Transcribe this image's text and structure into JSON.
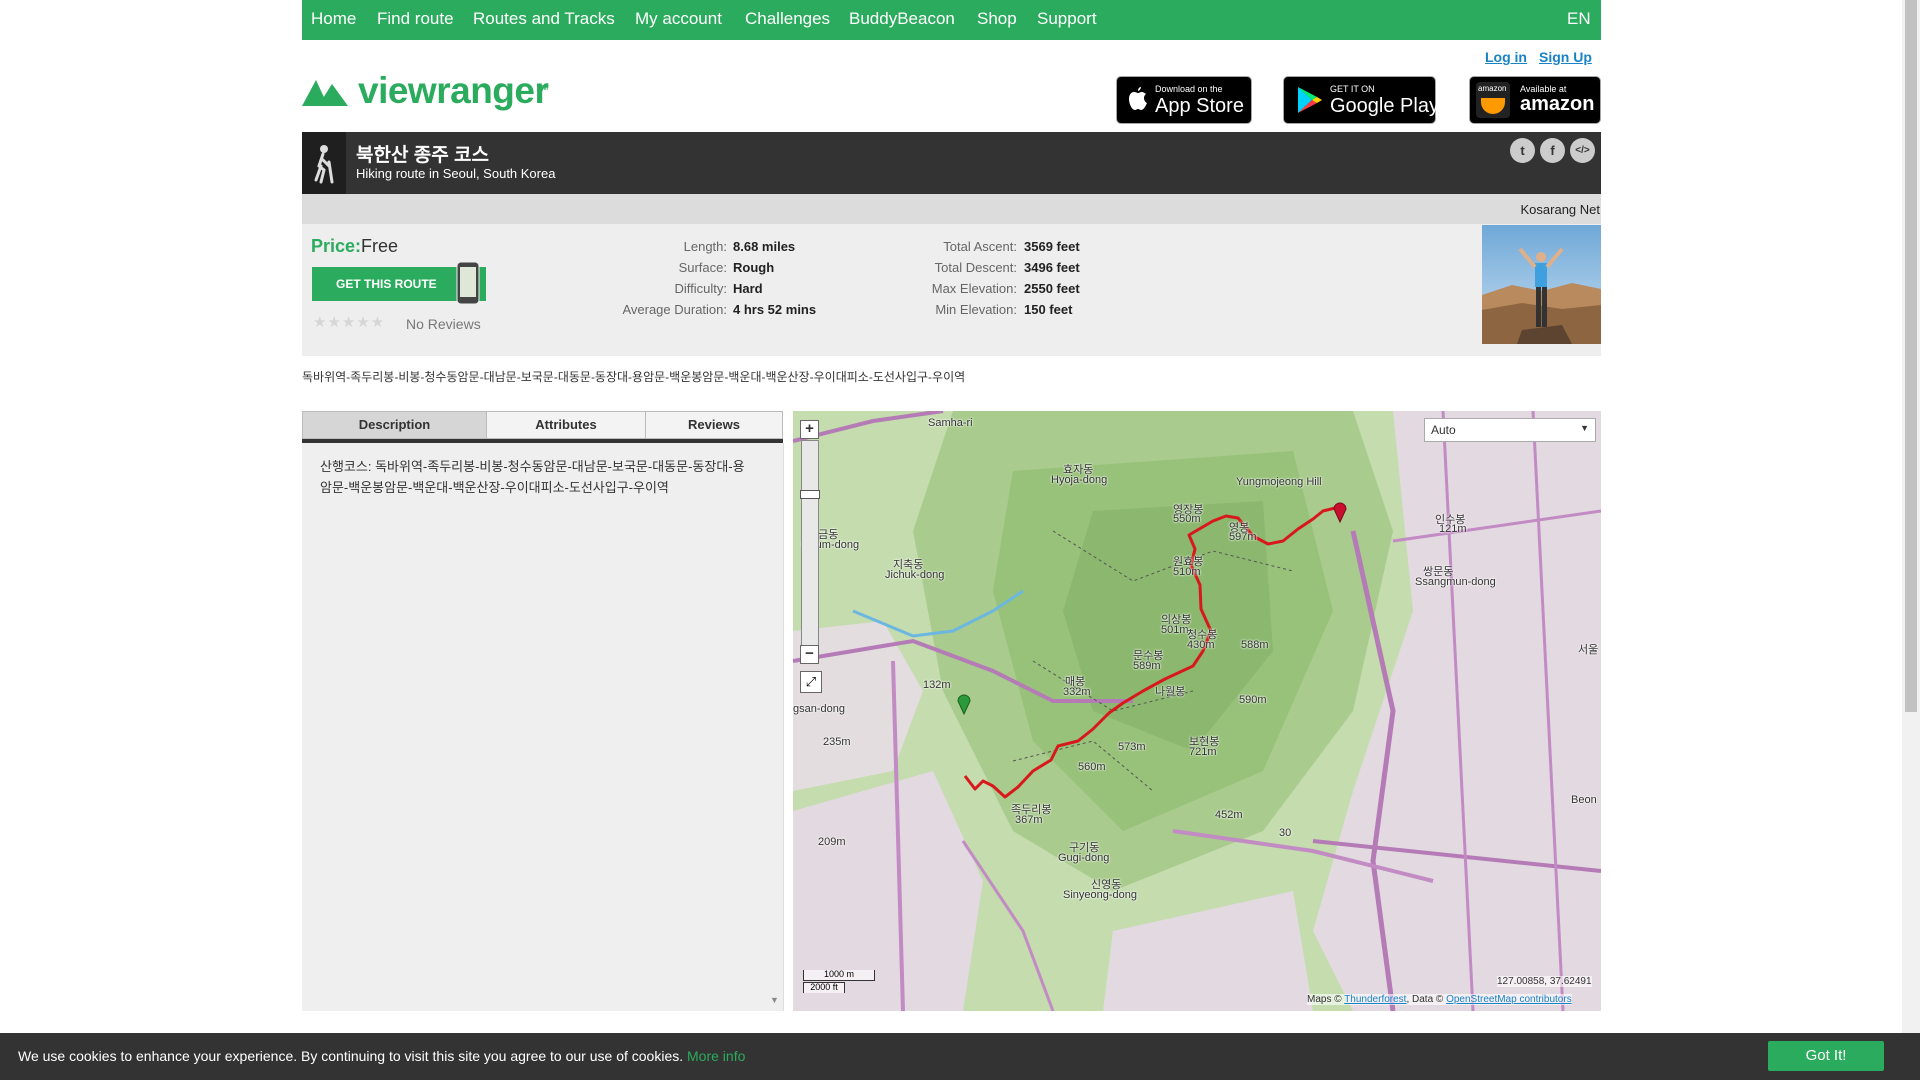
{
  "nav": {
    "items": [
      "Home",
      "Find route",
      "Routes and Tracks",
      "My account",
      "Challenges",
      "BuddyBeacon",
      "Shop",
      "Support"
    ],
    "language": "EN"
  },
  "auth": {
    "login": "Log in",
    "signup": "Sign Up"
  },
  "logo": {
    "text": "viewranger",
    "tm": "™",
    "brand_color": "#2bab5d"
  },
  "badges": {
    "app_store": {
      "small": "Download on the",
      "big": "App Store"
    },
    "google_play": {
      "small": "GET IT ON",
      "big": "Google Play"
    },
    "amazon": {
      "logo_text": "amazon",
      "small": "Available at",
      "big": "amazon"
    }
  },
  "route": {
    "title": "북한산 종주 코스",
    "subtitle": "Hiking route in Seoul, South Korea",
    "author": "Kosarang Net",
    "icon": "hiker-icon"
  },
  "share": [
    "twitter-icon",
    "facebook-icon",
    "embed-icon"
  ],
  "share_glyphs": [
    "t",
    "f",
    "</>"
  ],
  "price": {
    "label": "Price:",
    "value": "Free",
    "button": "GET THIS ROUTE"
  },
  "reviews": {
    "stars": "★★★★★",
    "text": "No Reviews"
  },
  "stats_left": [
    {
      "label": "Length:",
      "value": "8.68 miles"
    },
    {
      "label": "Surface:",
      "value": "Rough"
    },
    {
      "label": "Difficulty:",
      "value": "Hard"
    },
    {
      "label": "Average Duration:",
      "value": "4 hrs 52 mins"
    }
  ],
  "stats_right": [
    {
      "label": "Total Ascent:",
      "value": "3569 feet"
    },
    {
      "label": "Total Descent:",
      "value": "3496 feet"
    },
    {
      "label": "Max Elevation:",
      "value": "2550 feet"
    },
    {
      "label": "Min Elevation:",
      "value": "150 feet"
    }
  ],
  "route_line": "독바위역-족두리봉-비봉-청수동암문-대남문-보국문-대동문-동장대-용암문-백운봉암문-백운대-백운산장-우이대피소-도선사입구-우이역",
  "tabs": [
    "Description",
    "Attributes",
    "Reviews"
  ],
  "description": "산행코스: 독바위역-족두리봉-비봉-청수동암문-대남문-보국문-대동문-동장대-용암문-백운봉암문-백운대-백운산장-우이대피소-도선사입구-우이역",
  "map": {
    "layer_select": "Auto",
    "zoom_in": "+",
    "zoom_out": "−",
    "scale_m": "1000 m",
    "scale_ft": "2000 ft",
    "coords": "127.00858, 37.62491",
    "attribution_prefix": "Maps © ",
    "attribution_link1": "Thunderforest",
    "attribution_mid": ", Data © ",
    "attribution_link2": "OpenStreetMap contributors",
    "route_color": "#d7191c",
    "labels": [
      "Samha-ri",
      "효자동",
      "Hyoja-dong",
      "Yungmojeong Hill",
      "오금동",
      "Oeum-dong",
      "지축동",
      "Jichuk-dong",
      "영장봉",
      "550m",
      "원효봉",
      "510m",
      "영봉",
      "597m",
      "인수봉",
      "121m",
      "쌍문동",
      "Ssangmun-dong",
      "서울",
      "의상봉",
      "501m",
      "청수봉",
      "430m",
      "문수봉",
      "589m",
      "588m",
      "매봉",
      "332m",
      "나월봉",
      "590m",
      "132m",
      "235m",
      "560m",
      "573m",
      "보현봉",
      "721m",
      "족두리봉",
      "367m",
      "452m",
      "209m",
      "구기동",
      "Gugi-dong",
      "신영동",
      "Sinyeong-dong",
      "gsan-dong",
      "Beon",
      "30",
      "5",
      "1"
    ]
  },
  "cookie": {
    "text": "We use cookies to enhance your experience. By continuing to visit this site you agree to our use of cookies.",
    "more": "More info",
    "button": "Got It!"
  }
}
